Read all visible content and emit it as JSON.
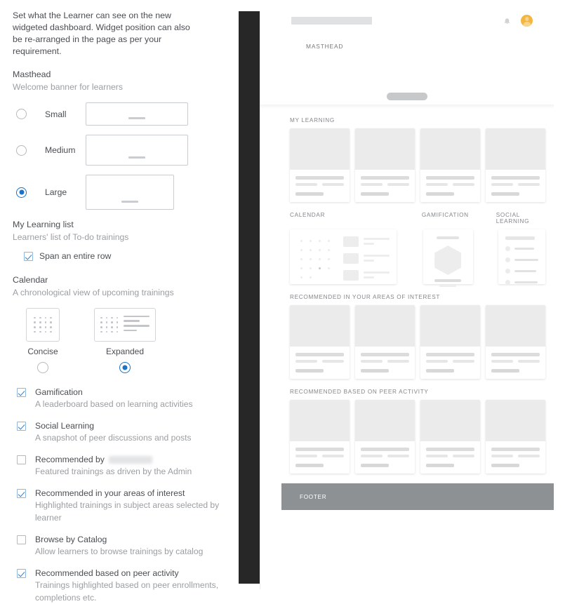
{
  "settings": {
    "intro": "Set what the Learner can see on the new widgeted dashboard. Widget position can also be re-arranged in the page as per your requirement.",
    "masthead": {
      "title": "Masthead",
      "subtitle": "Welcome banner for learners",
      "options": [
        {
          "label": "Small",
          "selected": false
        },
        {
          "label": "Medium",
          "selected": false
        },
        {
          "label": "Large",
          "selected": true
        }
      ]
    },
    "my_learning": {
      "title": "My Learning list",
      "subtitle": "Learners' list of To-do trainings",
      "span_row_label": "Span an entire row",
      "span_row_checked": true
    },
    "calendar": {
      "title": "Calendar",
      "subtitle": "A chronological view of upcoming trainings",
      "styles": [
        {
          "label": "Concise",
          "selected": false
        },
        {
          "label": "Expanded",
          "selected": true
        }
      ]
    },
    "widgets": [
      {
        "name": "Gamification",
        "desc": "A leaderboard based on learning activities",
        "checked": true,
        "redacted": false
      },
      {
        "name": "Social Learning",
        "desc": "A snapshot of peer discussions and posts",
        "checked": true,
        "redacted": false
      },
      {
        "name": "Recommended by",
        "desc": "Featured trainings as driven by the Admin",
        "checked": false,
        "redacted": true
      },
      {
        "name": "Recommended in your areas of interest",
        "desc": "Highlighted trainings in subject areas selected by learner",
        "checked": true,
        "redacted": false
      },
      {
        "name": "Browse by Catalog",
        "desc": "Allow learners to browse trainings by catalog",
        "checked": false,
        "redacted": false
      },
      {
        "name": "Recommended based on peer activity",
        "desc": "Trainings highlighted based on peer enrollments, completions etc.",
        "checked": true,
        "redacted": false
      }
    ]
  },
  "preview": {
    "masthead_label": "MASTHEAD",
    "sections": {
      "my_learning": "MY LEARNING",
      "calendar": "CALENDAR",
      "gamification": "GAMIFICATION",
      "social_learning": "SOCIAL LEARNING",
      "areas_of_interest": "RECOMMENDED IN YOUR AREAS OF INTEREST",
      "peer_activity": "RECOMMENDED BASED ON PEER ACTIVITY"
    },
    "footer_label": "FOOTER",
    "card_counts": {
      "my_learning": 4,
      "areas_of_interest": 4,
      "peer_activity": 4
    },
    "colors": {
      "accent": "#1a73c4",
      "avatar": "#f3b643",
      "footer": "#8e9194",
      "rail": "#272727"
    }
  }
}
